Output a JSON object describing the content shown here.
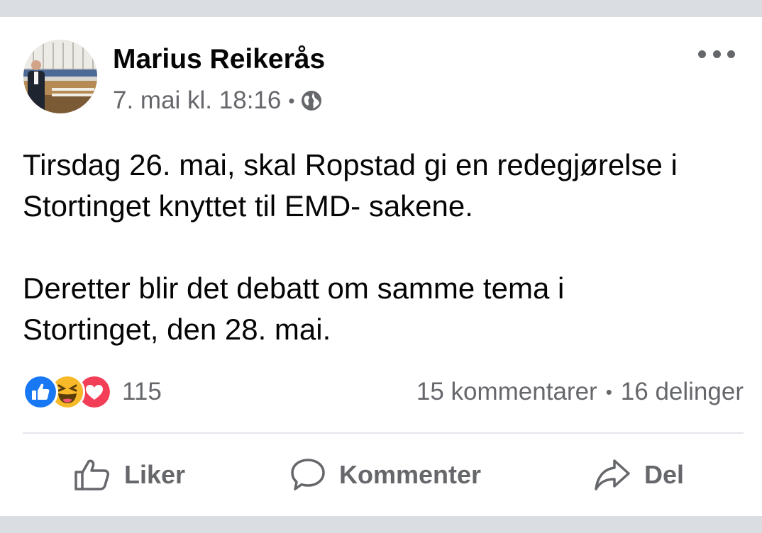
{
  "post": {
    "author": "Marius Reikerås",
    "timestamp": "7. mai kl. 18:16",
    "meta_separator": "•",
    "audience_icon": "globe-icon",
    "more_icon": "more-options-icon",
    "paragraphs": [
      {
        "line1": "Tirsdag 26. mai, skal Ropstad gi en redegjørelse i",
        "line2": "Stortinget knyttet til EMD- sakene."
      },
      {
        "line1": "Deretter blir det debatt om samme tema i",
        "line2": "Stortinget, den 28. mai."
      }
    ]
  },
  "engagement": {
    "reaction_icons": [
      "like-reaction-icon",
      "haha-reaction-icon",
      "love-reaction-icon"
    ],
    "reaction_count": "115",
    "comments": "15 kommentarer",
    "stats_separator": "•",
    "shares": "16 delinger"
  },
  "actions": {
    "like_label": "Liker",
    "comment_label": "Kommenter",
    "share_label": "Del"
  },
  "colors": {
    "background": "#dadde2",
    "card": "#ffffff",
    "text_primary": "#050505",
    "text_secondary": "#65676b",
    "like_blue": "#1877f2",
    "love_red": "#f33e58",
    "haha_yellow": "#f7b928"
  }
}
